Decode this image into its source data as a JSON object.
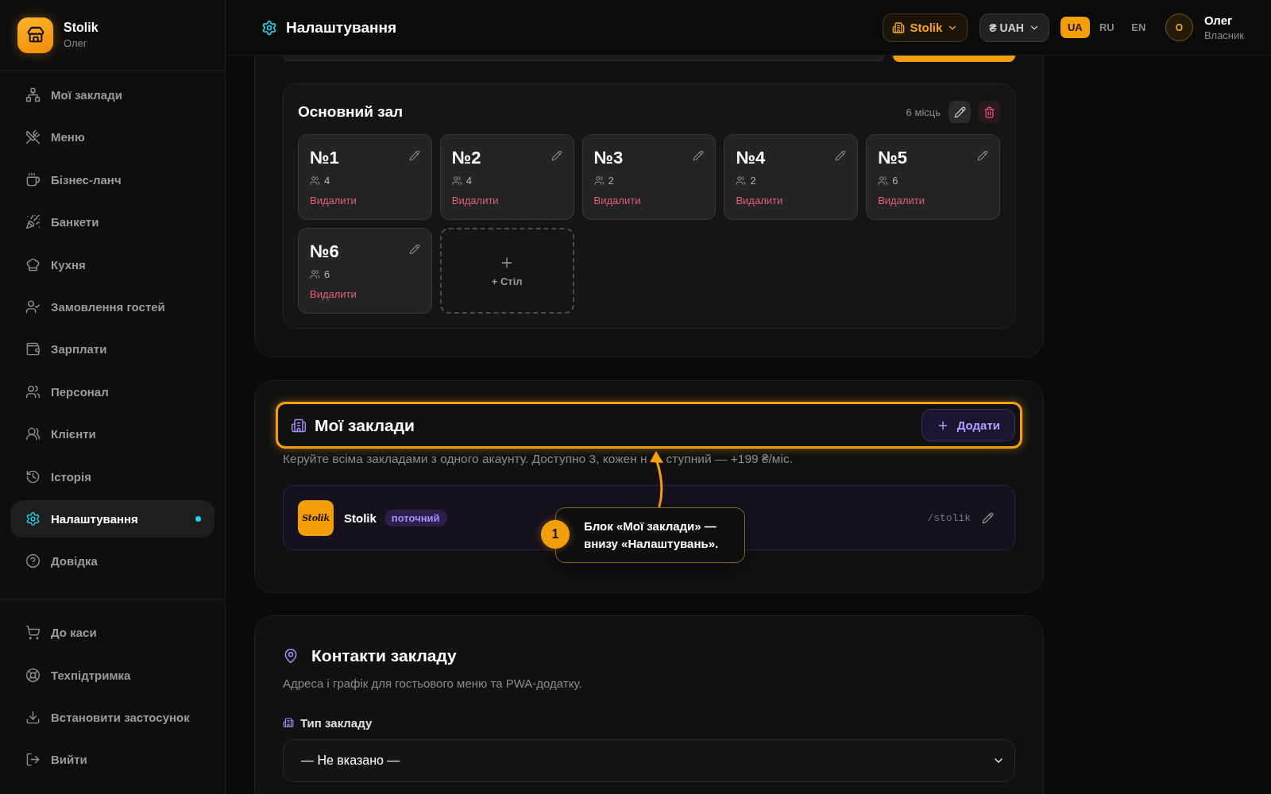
{
  "sidebar": {
    "brand": {
      "name": "Stolik",
      "user": "Олег"
    },
    "nav": [
      {
        "label": "Мої заклади",
        "selected": false
      },
      {
        "label": "Меню",
        "selected": false
      },
      {
        "label": "Бізнес-ланч",
        "selected": false
      },
      {
        "label": "Банкети",
        "selected": false
      },
      {
        "label": "Кухня",
        "selected": false
      },
      {
        "label": "Замовлення гостей",
        "selected": false
      },
      {
        "label": "Зарплати",
        "selected": false
      },
      {
        "label": "Персонал",
        "selected": false
      },
      {
        "label": "Клієнти",
        "selected": false
      },
      {
        "label": "Історія",
        "selected": false
      },
      {
        "label": "Налаштування",
        "selected": true
      },
      {
        "label": "Довідка",
        "selected": false
      }
    ],
    "footer_nav": [
      {
        "label": "До каси"
      },
      {
        "label": "Техпідтримка"
      },
      {
        "label": "Встановити застосунок"
      },
      {
        "label": "Вийти"
      }
    ]
  },
  "header": {
    "title": "Налаштування",
    "venue_button": "Stolik",
    "currency_button": "₴ UAH",
    "languages": [
      {
        "label": "UA",
        "selected": true
      },
      {
        "label": "RU",
        "selected": false
      },
      {
        "label": "EN",
        "selected": false
      }
    ],
    "user": {
      "initial": "О",
      "name": "Олег",
      "role": "Власник"
    }
  },
  "hall": {
    "title": "Основний зал",
    "seats": "6 місць",
    "tables": [
      {
        "number": "№1",
        "guests": "4",
        "delete": "Видалити"
      },
      {
        "number": "№2",
        "guests": "4",
        "delete": "Видалити"
      },
      {
        "number": "№3",
        "guests": "2",
        "delete": "Видалити"
      },
      {
        "number": "№4",
        "guests": "2",
        "delete": "Видалити"
      },
      {
        "number": "№5",
        "guests": "6",
        "delete": "Видалити"
      },
      {
        "number": "№6",
        "guests": "6",
        "delete": "Видалити"
      }
    ],
    "add_table": "+ Стіл"
  },
  "my_venues": {
    "title": "Мої заклади",
    "add_button": "Додати",
    "description": [
      "Керуйте всіма закладами з одного акаунту. Доступно 3, кожен н",
      "ступний — +199 ₴/міс."
    ],
    "venues": [
      {
        "logo_text": "Stolik",
        "name": "Stolik",
        "tag": "поточний",
        "slug": "/stolik"
      }
    ]
  },
  "tutorial": {
    "step": "1",
    "text": "Блок «Мої заклади» — внизу «Налаштувань»."
  },
  "contacts": {
    "title": "Контакти закладу",
    "description": "Адреса і графік для гостьового меню та PWA-додатку.",
    "fields": [
      {
        "label": "Тип закладу",
        "value": "— Не вказано —"
      }
    ]
  }
}
